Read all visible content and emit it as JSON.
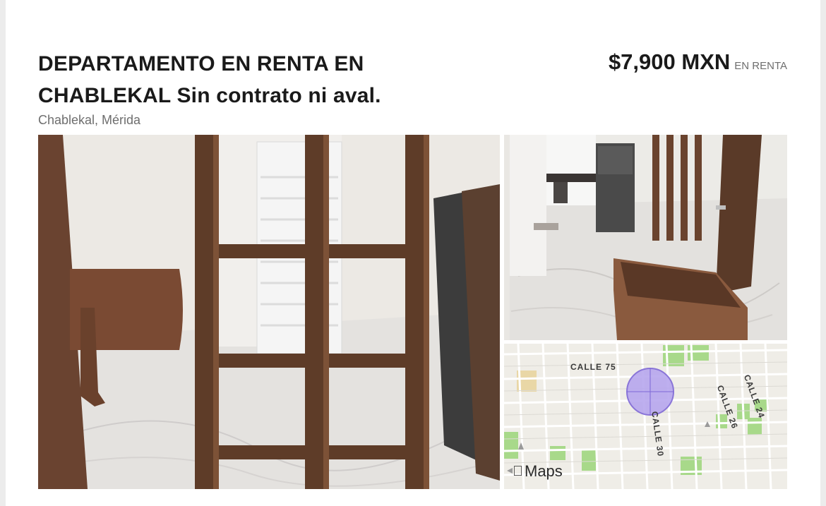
{
  "listing": {
    "title": "DEPARTAMENTO EN RENTA EN CHABLEKAL Sin contrato ni aval.",
    "location": "Chablekal, Mérida",
    "price": "$7,900 MXN",
    "price_tag": "EN RENTA"
  },
  "map": {
    "streets": [
      "CALLE 75",
      "CALLE 30",
      "CALLE 26",
      "CALLE 24"
    ],
    "logo": "Maps",
    "logo_icon": "apple-icon"
  },
  "colors": {
    "text_primary": "#1a1a1a",
    "text_secondary": "#6e6e6e",
    "map_marker": "#b7a7ee",
    "map_park": "#a8d98a"
  }
}
